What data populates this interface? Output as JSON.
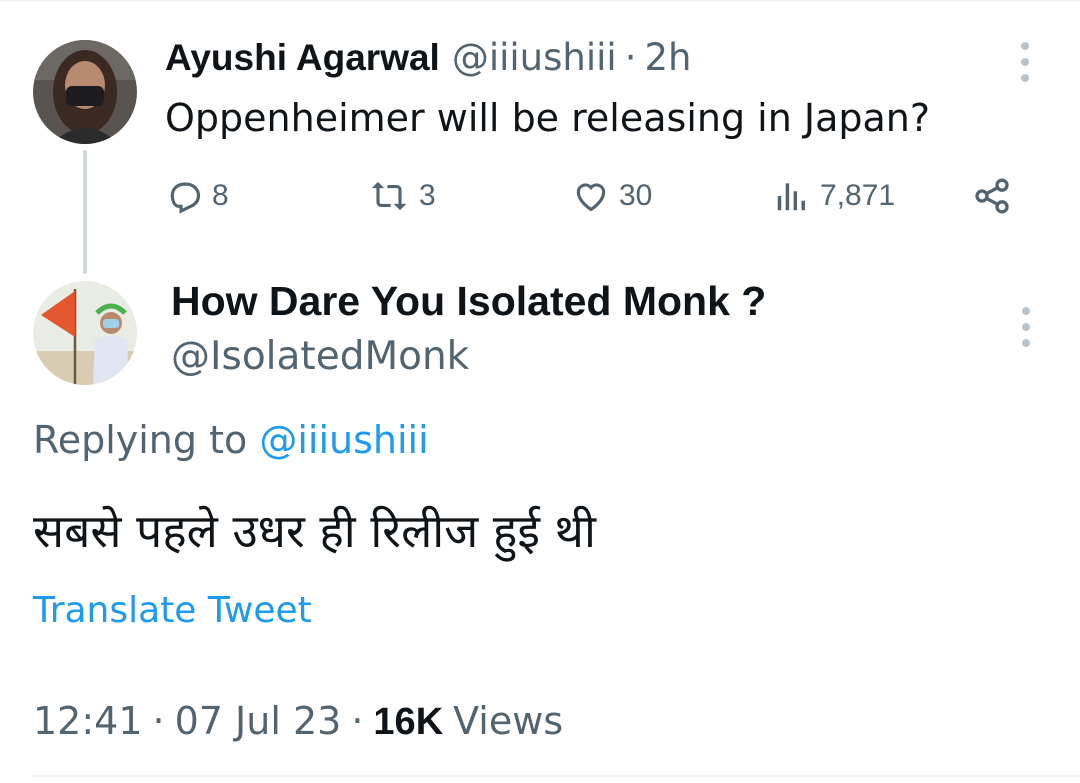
{
  "tweet1": {
    "author_name": "Ayushi Agarwal",
    "author_handle": "@iiiushiii",
    "separator": "·",
    "time_ago": "2h",
    "text": "Oppenheimer will be releasing in Japan?",
    "actions": {
      "replies": "8",
      "retweets": "3",
      "likes": "30",
      "views": "7,871"
    },
    "icons": [
      "reply-icon",
      "retweet-icon",
      "like-icon",
      "views-icon",
      "share-icon",
      "more-icon"
    ]
  },
  "tweet2": {
    "author_name": "How Dare You Isolated Monk ?",
    "author_handle": "@IsolatedMonk",
    "replying_prefix": "Replying to",
    "replying_to": "@iiiushiii",
    "text": "सबसे पहले उधर ही रिलीज हुई थी",
    "translate_label": "Translate Tweet",
    "timestamp_time": "12:41",
    "timestamp_sep": "·",
    "timestamp_date": "07 Jul 23",
    "views_count": "16K",
    "views_label": "Views"
  },
  "colors": {
    "text_primary": "#0f1419",
    "text_secondary": "#536471",
    "link": "#1d9bf0",
    "divider": "#eff3f4"
  }
}
